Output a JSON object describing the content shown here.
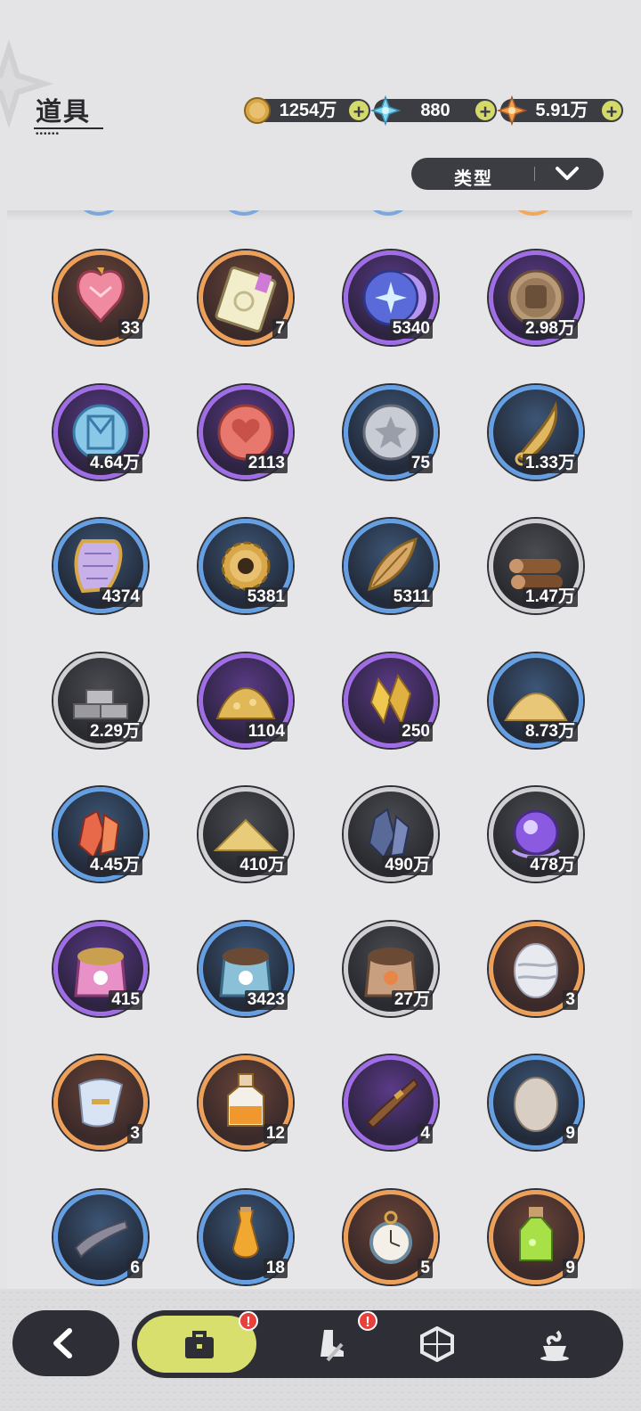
{
  "header": {
    "title": "道具",
    "currencies": [
      {
        "name": "gold-coin",
        "value": "1254万",
        "plus": "+"
      },
      {
        "name": "crystal-star",
        "value": "880",
        "plus": "+"
      },
      {
        "name": "orange-star",
        "value": "5.91万",
        "plus": "+"
      }
    ]
  },
  "filter": {
    "label": "类型"
  },
  "items": [
    {
      "name": "pink-heart-gem",
      "rarity": "orange",
      "count": "33"
    },
    {
      "name": "rainbow-ticket",
      "rarity": "orange",
      "count": "7"
    },
    {
      "name": "star-moon-coin",
      "rarity": "purple",
      "count": "5340"
    },
    {
      "name": "fist-coin",
      "rarity": "purple",
      "count": "2.98万"
    },
    {
      "name": "blue-rune-coin",
      "rarity": "purple",
      "count": "4.64万"
    },
    {
      "name": "red-heart-coin",
      "rarity": "purple",
      "count": "2113"
    },
    {
      "name": "silver-star-coin",
      "rarity": "blue",
      "count": "75"
    },
    {
      "name": "gold-horn",
      "rarity": "blue",
      "count": "1.33万"
    },
    {
      "name": "scale-shield",
      "rarity": "blue",
      "count": "4374"
    },
    {
      "name": "gear",
      "rarity": "blue",
      "count": "5381"
    },
    {
      "name": "gold-leaf",
      "rarity": "blue",
      "count": "5311"
    },
    {
      "name": "wood-logs",
      "rarity": "gray",
      "count": "1.47万"
    },
    {
      "name": "stone-bricks",
      "rarity": "gray",
      "count": "2.29万"
    },
    {
      "name": "gold-ore-pile",
      "rarity": "purple",
      "count": "1104"
    },
    {
      "name": "gold-crystals",
      "rarity": "purple",
      "count": "250"
    },
    {
      "name": "gold-sand-pile",
      "rarity": "blue",
      "count": "8.73万"
    },
    {
      "name": "red-crystal",
      "rarity": "blue",
      "count": "4.45万"
    },
    {
      "name": "yellow-sand",
      "rarity": "gray",
      "count": "410万"
    },
    {
      "name": "dark-crystal",
      "rarity": "gray",
      "count": "490万"
    },
    {
      "name": "purple-orb",
      "rarity": "gray",
      "count": "478万"
    },
    {
      "name": "pink-food-bag",
      "rarity": "purple",
      "count": "415"
    },
    {
      "name": "blue-food-bag",
      "rarity": "blue",
      "count": "3423"
    },
    {
      "name": "brown-food-bag",
      "rarity": "gray",
      "count": "27万"
    },
    {
      "name": "white-egg",
      "rarity": "orange",
      "count": "3"
    },
    {
      "name": "white-scroll",
      "rarity": "orange",
      "count": "3"
    },
    {
      "name": "orange-potion",
      "rarity": "orange",
      "count": "12"
    },
    {
      "name": "brown-brush",
      "rarity": "purple",
      "count": "4"
    },
    {
      "name": "plain-egg",
      "rarity": "blue",
      "count": "9"
    },
    {
      "name": "gray-brush",
      "rarity": "blue",
      "count": "6"
    },
    {
      "name": "small-potion",
      "rarity": "blue",
      "count": "18"
    },
    {
      "name": "pocket-watch",
      "rarity": "orange",
      "count": "5"
    },
    {
      "name": "green-potion",
      "rarity": "orange",
      "count": "9"
    }
  ],
  "bottom_nav": {
    "tabs": [
      {
        "name": "bag",
        "badge": "!"
      },
      {
        "name": "boots-sword",
        "badge": "!"
      },
      {
        "name": "hexagon-gem",
        "badge": ""
      },
      {
        "name": "swirl-cup",
        "badge": ""
      }
    ]
  },
  "colors": {
    "accent": "#d8df6c",
    "dark": "#2e2f36",
    "badge": "#e8403c"
  }
}
